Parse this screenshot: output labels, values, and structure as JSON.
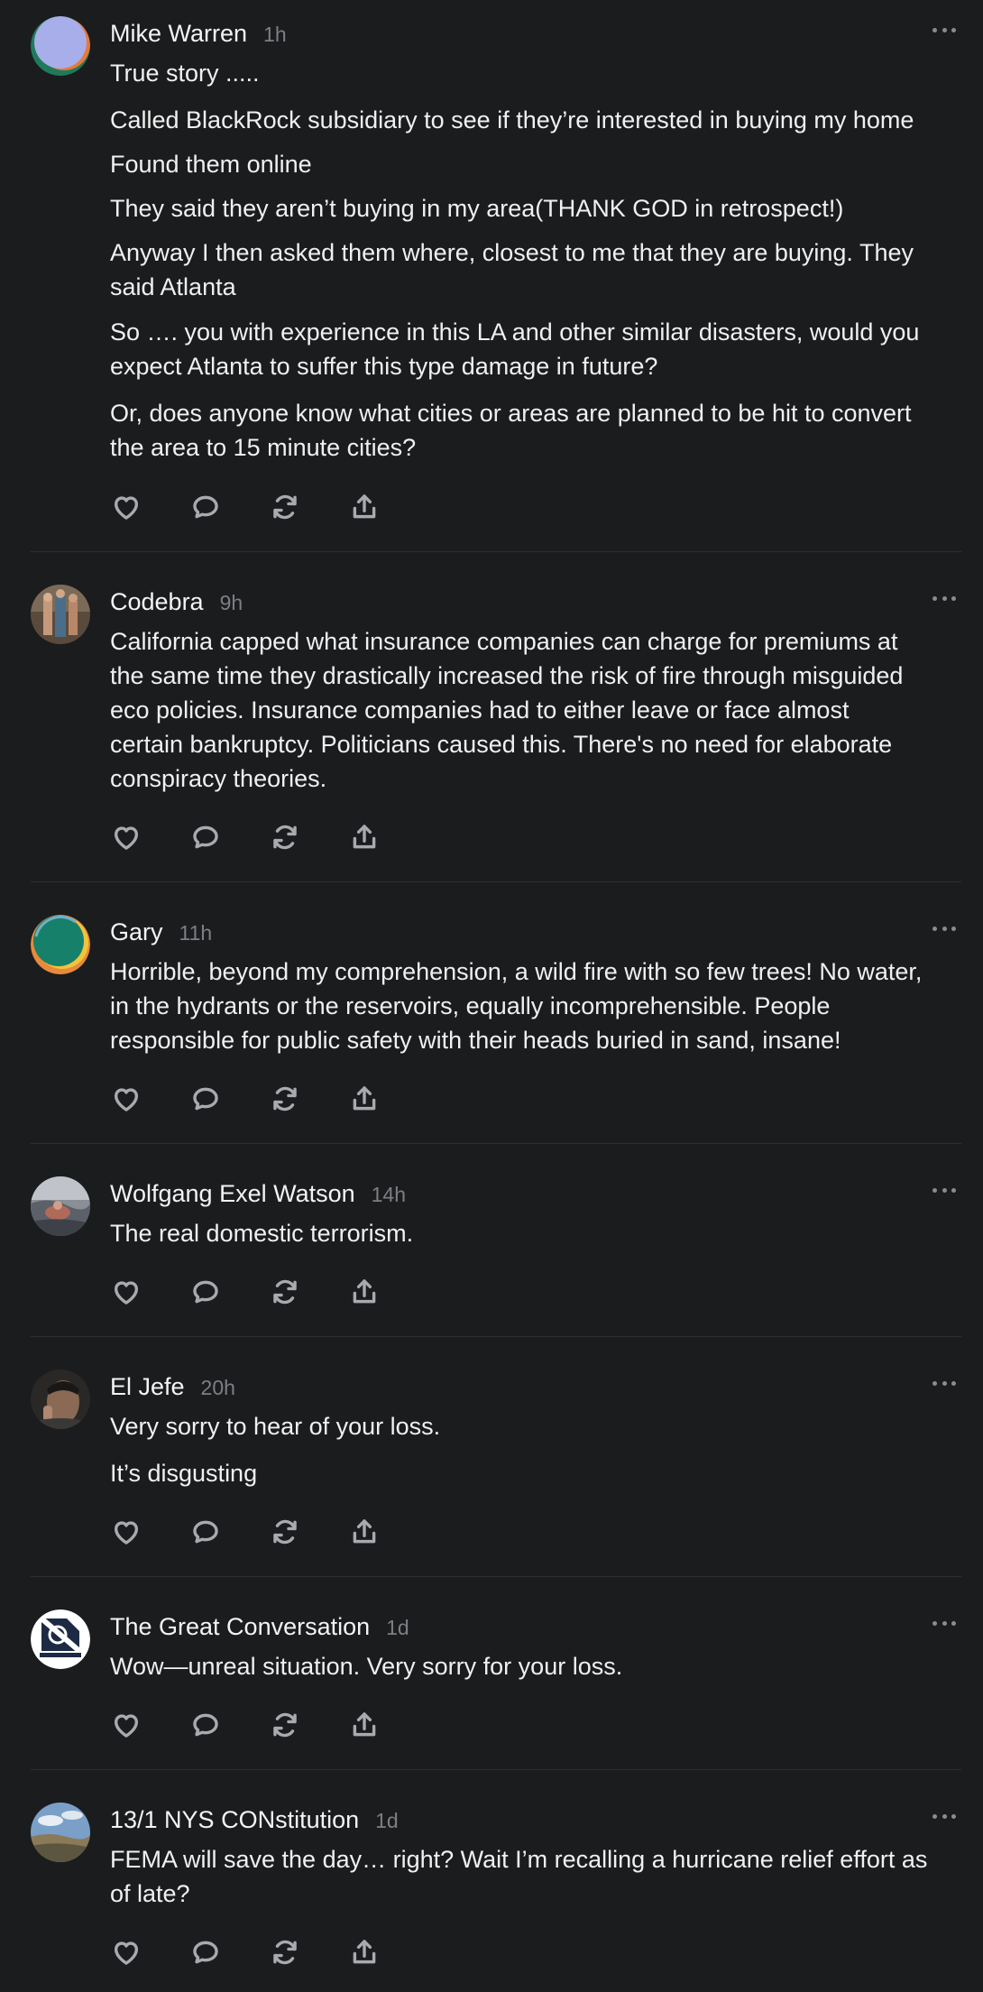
{
  "comments": [
    {
      "author": "Mike Warren",
      "time": "1h",
      "paragraphs": [
        [
          "True story ....."
        ],
        [
          "Called BlackRock subsidiary to see if they’re interested in buying my home"
        ],
        [
          "Found them online"
        ],
        [
          "They said they aren’t buying in my area(THANK GOD in retrospect!)"
        ],
        [
          "Anyway I then asked them where, closest to me that they are buying. They",
          "said Atlanta"
        ],
        [
          "So …. you with experience in this LA and other similar disasters, would you",
          "expect Atlanta to suffer this type damage in future?"
        ],
        [
          "Or, does anyone know what cities or areas are planned to be hit to convert",
          "the area to 15 minute cities?"
        ]
      ]
    },
    {
      "author": "Codebra",
      "time": "9h",
      "paragraphs": [
        [
          "California capped what insurance companies can charge for premiums at",
          "the same time they drastically increased the risk of fire through misguided",
          "eco policies. Insurance companies had to either leave or face almost",
          "certain bankruptcy. Politicians caused this. There's no need for elaborate",
          "conspiracy theories."
        ]
      ]
    },
    {
      "author": "Gary",
      "time": "11h",
      "paragraphs": [
        [
          "Horrible, beyond my comprehension, a wild fire with so few trees! No water,",
          "in the hydrants or the reservoirs, equally incomprehensible. People",
          "responsible for public safety with their heads buried in sand, insane!"
        ]
      ]
    },
    {
      "author": "Wolfgang Exel Watson",
      "time": "14h",
      "paragraphs": [
        [
          "The real domestic terrorism."
        ]
      ]
    },
    {
      "author": "El Jefe",
      "time": "20h",
      "paragraphs": [
        [
          "Very sorry to hear of your loss."
        ],
        [
          "It’s disgusting"
        ]
      ]
    },
    {
      "author": "The Great Conversation",
      "time": "1d",
      "paragraphs": [
        [
          "Wow—unreal situation. Very sorry for your loss."
        ]
      ]
    },
    {
      "author": "13/1 NYS CONstitution",
      "time": "1d",
      "paragraphs": [
        [
          "FEMA will save the day… right? Wait I’m recalling a hurricane relief effort as",
          "of late?"
        ]
      ]
    }
  ],
  "action_icons": [
    "heart-icon",
    "comment-icon",
    "restack-icon",
    "share-icon"
  ],
  "more_icon": "more-horizontal-icon",
  "colors": {
    "background": "#1b1c1e",
    "text": "#f0f0f0",
    "muted": "#7d7f84",
    "icon": "#a8aaaf",
    "divider": "#2e2f33"
  }
}
